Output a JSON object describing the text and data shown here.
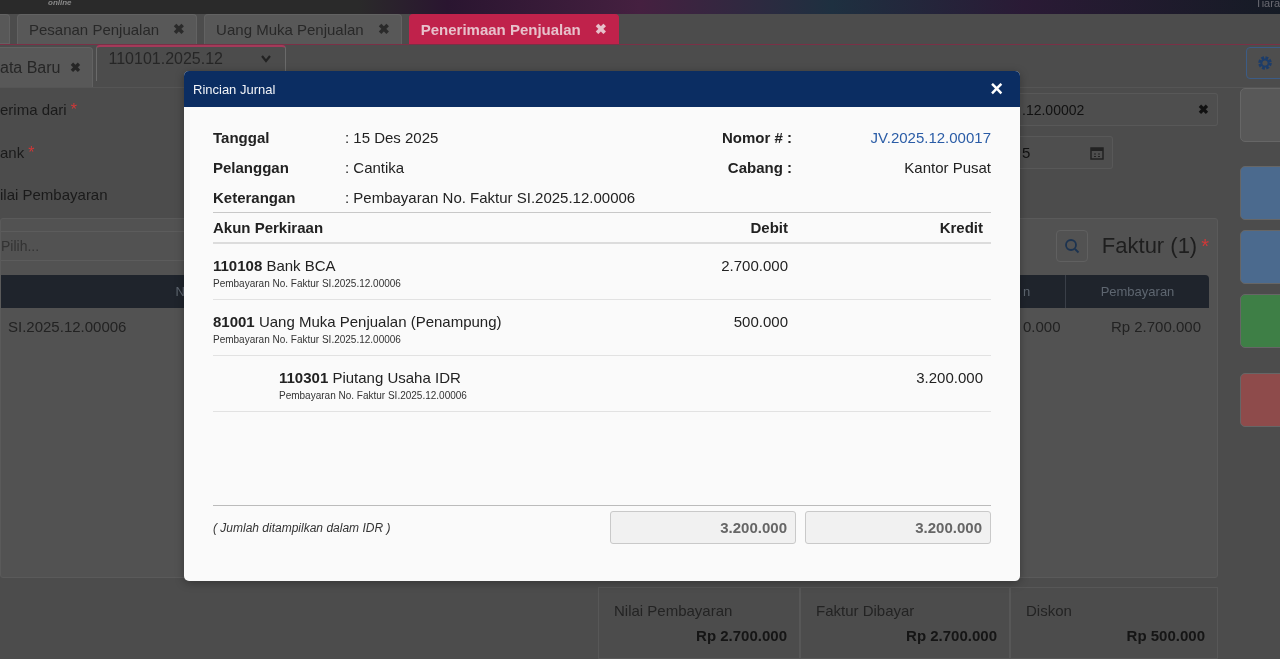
{
  "banner": {
    "tagline": "online",
    "user": "Tiara"
  },
  "tabs": [
    {
      "label": "Pesanan Penjualan",
      "selected": false,
      "close": "✖"
    },
    {
      "label": "Uang Muka Penjualan",
      "selected": false,
      "close": "✖"
    },
    {
      "label": "Penerimaan Penjualan",
      "selected": true,
      "close": "✖"
    }
  ],
  "subtabs": [
    {
      "label": "ata Baru",
      "selected": false,
      "kind": "close",
      "icon": "✖"
    },
    {
      "label": "110101.2025.12",
      "selected": true,
      "kind": "dropdown"
    }
  ],
  "form": {
    "fields": [
      {
        "label": "erima dari",
        "required_mark": "*"
      },
      {
        "label": "ank",
        "required_mark": "*"
      },
      {
        "label": "ilai Pembayaran"
      }
    ],
    "customer_field": {
      "value": ".12.00002",
      "clear": "✖"
    },
    "date_field": {
      "value": "5"
    }
  },
  "side_buttons": [
    {
      "color": "#585858"
    },
    {
      "color": "#4b6a8e"
    },
    {
      "color": "#4b6a8e"
    },
    {
      "color": "#3e7f46"
    },
    {
      "color": "#8e4b4b"
    }
  ],
  "panel": {
    "search": {
      "placeholder": "Pilih..."
    },
    "title": "Faktur (1)",
    "required_mark": "*",
    "columns": [
      {
        "label": "N"
      },
      {
        "label": "n"
      },
      {
        "label": "Pembayaran"
      }
    ],
    "rows": [
      [
        "SI.2025.12.00006",
        "0.000",
        "Rp 2.700.000"
      ]
    ]
  },
  "summary": [
    {
      "label": "Nilai Pembayaran",
      "value": "Rp 2.700.000"
    },
    {
      "label": "Faktur Dibayar",
      "value": "Rp 2.700.000"
    },
    {
      "label": "Diskon",
      "value": "Rp 500.000"
    }
  ],
  "modal": {
    "title": "Rincian Jurnal",
    "close": "×",
    "info_left": [
      {
        "label": "Tanggal",
        "value": ": 15 Des 2025"
      },
      {
        "label": "Pelanggan",
        "value": ": Cantika"
      },
      {
        "label": "Keterangan",
        "value": ": Pembayaran No. Faktur SI.2025.12.00006"
      }
    ],
    "info_right": [
      {
        "label": "Nomor # :",
        "value": "JV.2025.12.00017",
        "kind": "link"
      },
      {
        "label": "Cabang :",
        "value": "Kantor Pusat",
        "kind": "text"
      }
    ],
    "columns": [
      "Akun Perkiraan",
      "Debit",
      "Kredit"
    ],
    "entries": [
      {
        "account": "**110108** Bank BCA",
        "note": "Pembayaran No. Faktur SI.2025.12.00006",
        "amount": "2.700.000",
        "kind": "debit"
      },
      {
        "account": "**81001** Uang Muka Penjualan (Penampung)",
        "note": "Pembayaran No. Faktur SI.2025.12.00006",
        "amount": "500.000",
        "kind": "debit"
      },
      {
        "account": "**110301** Piutang Usaha IDR",
        "note": "Pembayaran No. Faktur SI.2025.12.00006",
        "amount": "3.200.000",
        "kind": "credit"
      }
    ],
    "footnote": "( Jumlah ditampilkan dalam IDR )",
    "total_debit": "3.200.000",
    "total_credit": "3.200.000"
  }
}
